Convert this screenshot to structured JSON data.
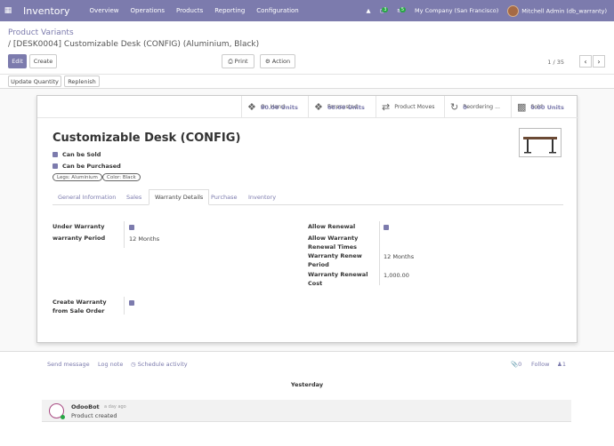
{
  "nav": {
    "app_name": "Inventory",
    "menu": [
      "Overview",
      "Operations",
      "Products",
      "Reporting",
      "Configuration"
    ],
    "company": "My Company (San Francisco)",
    "user": "Mitchell Admin (db_warranty)",
    "activity_count": "3",
    "message_count": "5"
  },
  "breadcrumb": {
    "parent": "Product Variants",
    "current": "/ [DESK0004] Customizable Desk (CONFIG) (Aluminium, Black)"
  },
  "buttons": {
    "edit": "Edit",
    "create": "Create",
    "print": "Print",
    "action": "Action",
    "update_qty": "Update Quantity",
    "replenish": "Replenish"
  },
  "pager": "1 / 35",
  "smart_buttons": [
    {
      "value": "80.00 Units",
      "label": "On Hand",
      "icon": "cubes-icon"
    },
    {
      "value": "60.00 Units",
      "label": "Forecasted",
      "icon": "cubes-icon"
    },
    {
      "value": "",
      "label": "Product Moves",
      "icon": "exchange-icon"
    },
    {
      "value": "0",
      "label": "Reordering ...",
      "icon": "refresh-icon"
    },
    {
      "value": "0.00 Units",
      "label": "Sold",
      "icon": "bar-chart-icon"
    }
  ],
  "product": {
    "name": "Customizable Desk (CONFIG)",
    "can_be_sold": "Can be Sold",
    "can_be_purchased": "Can be Purchased",
    "tags": [
      "Legs: Aluminium",
      "Color: Black"
    ]
  },
  "tabs": [
    "General Information",
    "Sales",
    "Warranty Details",
    "Purchase",
    "Inventory"
  ],
  "warranty": {
    "under_warranty_label": "Under Warranty",
    "period_label": "warranty Period",
    "period_value": "12 Months",
    "allow_renewal_label": "Allow Renewal",
    "allow_renewal_times_label": "Allow Warranty Renewal Times",
    "renew_period_label": "Warranty Renew Period",
    "renew_period_value": "12 Months",
    "renewal_cost_label": "Warranty Renewal Cost",
    "renewal_cost_value": "1,000.00",
    "create_from_so_label": "Create Warranty from Sale Order"
  },
  "chatter": {
    "send_message": "Send message",
    "log_note": "Log note",
    "schedule": "Schedule activity",
    "attachments": "0",
    "follow": "Follow",
    "followers": "1",
    "day": "Yesterday",
    "author": "OdooBot",
    "time": "a day ago",
    "body": "Product created"
  },
  "colors": {
    "brand": "#7c7bad",
    "success": "#28a745"
  }
}
